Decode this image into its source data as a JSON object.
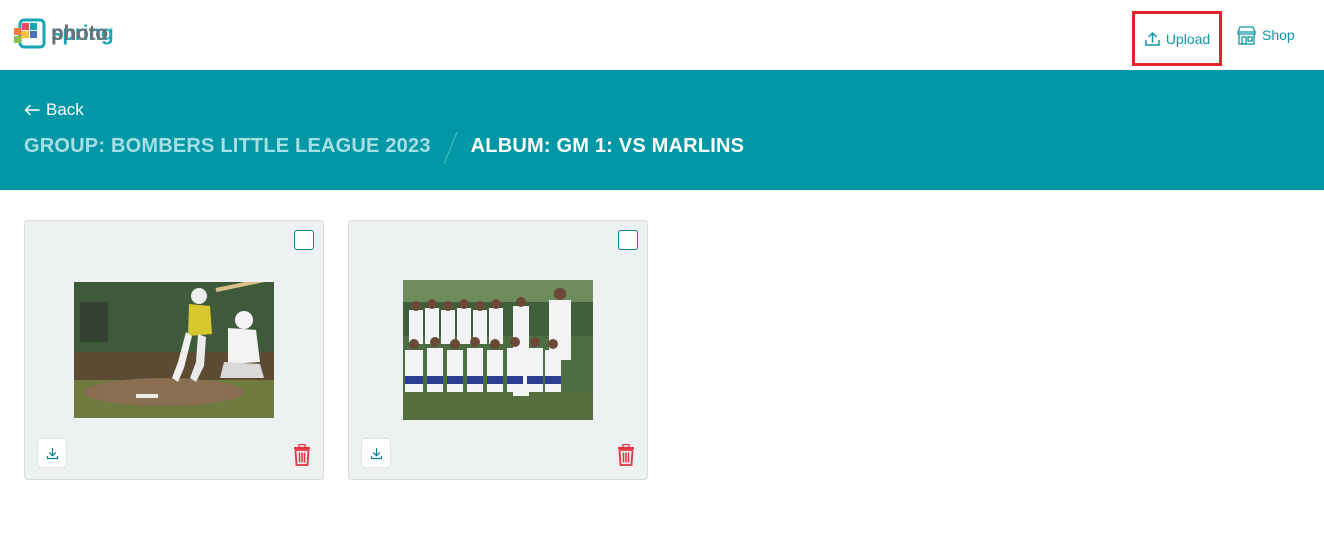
{
  "header": {
    "logo_part1": "photo",
    "logo_part2": "spring",
    "upload_label": "Upload",
    "shop_label": "Shop"
  },
  "hero": {
    "back_label": "Back",
    "group_crumb": "GROUP: BOMBERS LITTLE LEAGUE 2023",
    "album_crumb": "ALBUM: GM 1: VS MARLINS"
  },
  "photos": [
    {
      "subject": "baseball batter swinging with catcher",
      "icons": [
        "download-icon",
        "trash-icon"
      ]
    },
    {
      "subject": "baseball team group photo",
      "icons": [
        "download-icon",
        "trash-icon"
      ]
    }
  ],
  "colors": {
    "brand": "#0098a6",
    "accent_text": "#0f96a8",
    "highlight_border": "#e3242b",
    "delete": "#e63140"
  }
}
